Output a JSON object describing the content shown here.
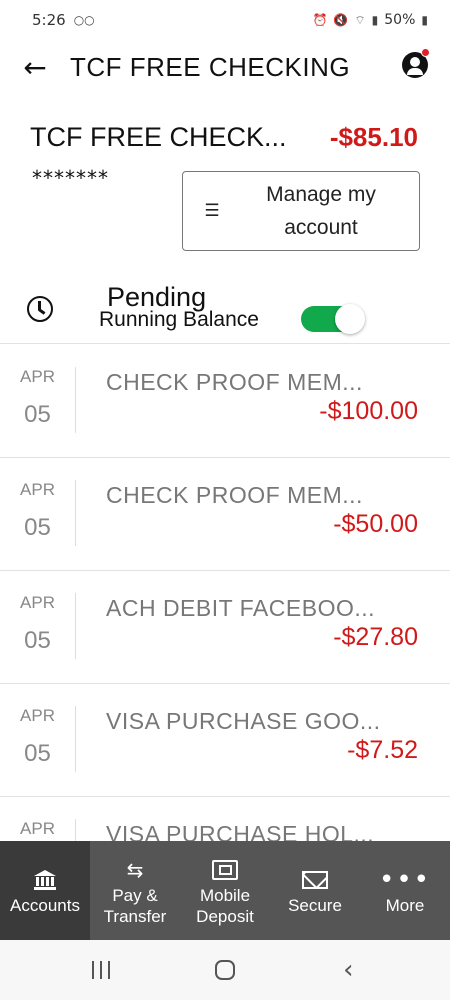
{
  "status_bar": {
    "time": "5:26",
    "voicemail_icon": "voicemail-icon",
    "battery": "50%"
  },
  "app_bar": {
    "title": "TCF FREE CHECKING",
    "back_icon": "back-arrow-icon",
    "profile_icon": "account-circle-icon"
  },
  "account": {
    "name": "TCF FREE CHECK...",
    "balance": "-$85.10",
    "masked_number": "*******",
    "manage_button": {
      "icon": "checklist-icon",
      "label": "Manage my account"
    }
  },
  "pending": {
    "label": "Pending",
    "running_balance_label": "Running Balance",
    "running_balance_on": true
  },
  "transactions": [
    {
      "month": "APR",
      "day": "05",
      "description": "CHECK PROOF MEM...",
      "amount": "-$100.00"
    },
    {
      "month": "APR",
      "day": "05",
      "description": "CHECK PROOF MEM...",
      "amount": "-$50.00"
    },
    {
      "month": "APR",
      "day": "05",
      "description": "ACH DEBIT FACEBOO...",
      "amount": "-$27.80"
    },
    {
      "month": "APR",
      "day": "05",
      "description": "VISA PURCHASE GOO...",
      "amount": "-$7.52"
    },
    {
      "month": "APR",
      "day": "",
      "description": "VISA PURCHASE HOL...",
      "amount": ""
    }
  ],
  "bottom_nav": {
    "accounts": "Accounts",
    "pay_transfer": "Pay & Transfer",
    "mobile_deposit": "Mobile Deposit",
    "secure": "Secure",
    "more": "More"
  },
  "colors": {
    "negative_amount": "#d01a1a",
    "toggle_on": "#11a94b",
    "nav_background": "#555555",
    "nav_active": "#3a3a3a"
  }
}
